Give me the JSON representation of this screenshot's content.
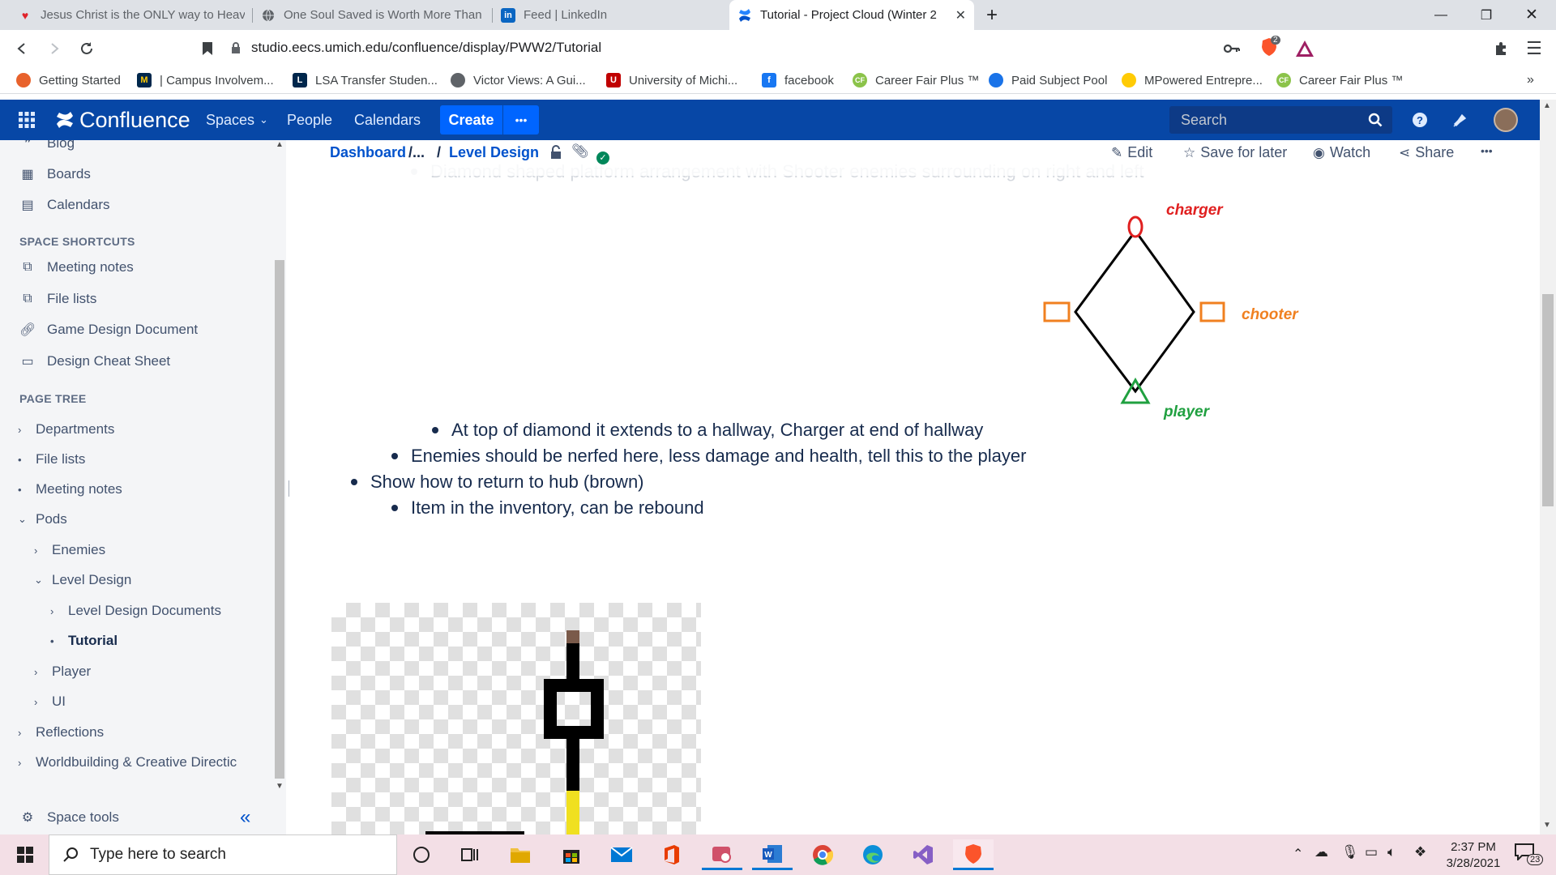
{
  "browser": {
    "tabs": [
      {
        "title": "Jesus Christ is the ONLY way to Heave",
        "icon": "heart-icon"
      },
      {
        "title": "One Soul Saved is Worth More Than A",
        "icon": "globe-icon"
      },
      {
        "title": "Feed | LinkedIn",
        "icon": "linkedin-icon"
      },
      {
        "title": "Tutorial - Project Cloud (Winter 2",
        "icon": "confluence-icon",
        "active": true
      }
    ],
    "url": "studio.eecs.umich.edu/confluence/display/PWW2/Tutorial",
    "brave_badge": "2",
    "bookmarks": [
      {
        "label": "Getting Started",
        "color": "#e8622c"
      },
      {
        "label": "| Campus Involvem...",
        "color": "#00274c"
      },
      {
        "label": "LSA Transfer Studen...",
        "color": "#00274c"
      },
      {
        "label": "Victor Views: A Gui...",
        "color": "#5f6368"
      },
      {
        "label": "University of Michi...",
        "color": "#c00000"
      },
      {
        "label": "facebook",
        "color": "#1877f2"
      },
      {
        "label": "Career Fair Plus ™",
        "color": "#8bc34a"
      },
      {
        "label": "Paid Subject Pool",
        "color": "#1a73e8"
      },
      {
        "label": "MPowered Entrepre...",
        "color": "#ffcb05"
      },
      {
        "label": "Career Fair Plus ™",
        "color": "#8bc34a"
      }
    ]
  },
  "confluence": {
    "logo": "Confluence",
    "nav": [
      "Spaces",
      "People",
      "Calendars"
    ],
    "create_label": "Create",
    "more_label": "•••",
    "search_placeholder": "Search"
  },
  "sidebar": {
    "top_items": [
      {
        "label": "Blog",
        "icon": "blog-icon"
      },
      {
        "label": "Boards",
        "icon": "board-icon"
      },
      {
        "label": "Calendars",
        "icon": "calendar-icon"
      }
    ],
    "shortcuts_heading": "SPACE SHORTCUTS",
    "shortcuts": [
      {
        "label": "Meeting notes",
        "icon": "copy-icon"
      },
      {
        "label": "File lists",
        "icon": "copy-icon"
      },
      {
        "label": "Game Design Document",
        "icon": "link-icon"
      },
      {
        "label": "Design Cheat Sheet",
        "icon": "page-icon"
      }
    ],
    "tree_heading": "PAGE TREE",
    "tree": [
      {
        "label": "Departments",
        "level": 0,
        "marker": "›"
      },
      {
        "label": "File lists",
        "level": 0,
        "marker": "•"
      },
      {
        "label": "Meeting notes",
        "level": 0,
        "marker": "•"
      },
      {
        "label": "Pods",
        "level": 0,
        "marker": "⌄"
      },
      {
        "label": "Enemies",
        "level": 1,
        "marker": "›"
      },
      {
        "label": "Level Design",
        "level": 1,
        "marker": "⌄"
      },
      {
        "label": "Level Design Documents",
        "level": 2,
        "marker": "›"
      },
      {
        "label": "Tutorial",
        "level": 2,
        "marker": "•",
        "current": true
      },
      {
        "label": "Player",
        "level": 1,
        "marker": "›"
      },
      {
        "label": "UI",
        "level": 1,
        "marker": "›"
      },
      {
        "label": "Reflections",
        "level": 0,
        "marker": "›"
      },
      {
        "label": "Worldbuilding & Creative Directic",
        "level": 0,
        "marker": "›"
      }
    ],
    "space_tools": "Space tools",
    "collapse": "«"
  },
  "page": {
    "breadcrumb": [
      "Dashboard",
      "/...",
      "/",
      "Level Design"
    ],
    "actions": [
      "Edit",
      "Save for later",
      "Watch",
      "Share",
      "•••"
    ],
    "faded_bullet": "Diamond shaped platform arrangement with Shooter enemies surrounding on right and left",
    "bullets": [
      {
        "text": "At top of diamond it extends to a hallway, Charger at end of hallway",
        "level": 3
      },
      {
        "text": "Enemies should be nerfed here, less damage and health, tell this to the player",
        "level": 2
      },
      {
        "text": "Show how to return to hub (brown)",
        "level": 1
      },
      {
        "text": "Item in the inventory, can be rebound",
        "level": 2
      }
    ],
    "diagram": {
      "labels": {
        "charger": "charger",
        "shooter": "chooter",
        "player": "player"
      },
      "colors": {
        "charger": "#e02020",
        "shooter": "#f08020",
        "player": "#20a040"
      }
    }
  },
  "taskbar": {
    "search_placeholder": "Type here to search",
    "time": "2:37 PM",
    "date": "3/28/2021",
    "notification_count": "23"
  }
}
